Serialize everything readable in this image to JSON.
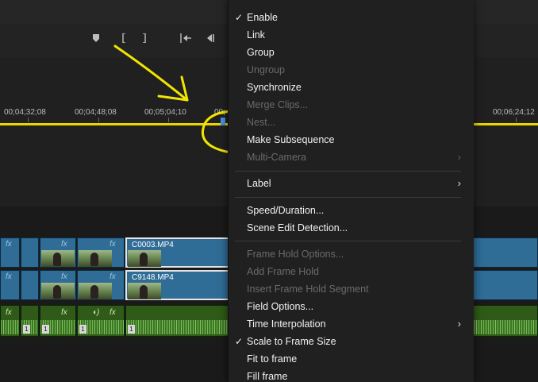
{
  "timeline": {
    "timecodes": [
      "00;04;32;08",
      "00;04;48;08",
      "00;05;04;10",
      "00;",
      "00;06;24;12"
    ],
    "toolbar_icons": [
      "marker-icon",
      "in-point-icon",
      "out-point-icon",
      "go-to-in-icon",
      "step-back-icon"
    ]
  },
  "tracks": {
    "video": [
      {
        "name": "C0003.MP4"
      },
      {
        "name": "C9148.MP4"
      }
    ],
    "fx_label": "fx",
    "audio_markers": [
      "1",
      "1",
      "1",
      "1"
    ]
  },
  "menu": {
    "items": [
      {
        "label": "Enable",
        "checked": true,
        "disabled": false,
        "submenu": false
      },
      {
        "label": "Link",
        "checked": false,
        "disabled": false,
        "submenu": false
      },
      {
        "label": "Group",
        "checked": false,
        "disabled": false,
        "submenu": false
      },
      {
        "label": "Ungroup",
        "checked": false,
        "disabled": true,
        "submenu": false
      },
      {
        "label": "Synchronize",
        "checked": false,
        "disabled": false,
        "submenu": false
      },
      {
        "label": "Merge Clips...",
        "checked": false,
        "disabled": true,
        "submenu": false
      },
      {
        "label": "Nest...",
        "checked": false,
        "disabled": true,
        "submenu": false
      },
      {
        "label": "Make Subsequence",
        "checked": false,
        "disabled": false,
        "submenu": false
      },
      {
        "label": "Multi-Camera",
        "checked": false,
        "disabled": true,
        "submenu": true
      },
      {
        "label": "Label",
        "checked": false,
        "disabled": false,
        "submenu": true
      },
      {
        "label": "Speed/Duration...",
        "checked": false,
        "disabled": false,
        "submenu": false
      },
      {
        "label": "Scene Edit Detection...",
        "checked": false,
        "disabled": false,
        "submenu": false
      },
      {
        "label": "Frame Hold Options...",
        "checked": false,
        "disabled": true,
        "submenu": false
      },
      {
        "label": "Add Frame Hold",
        "checked": false,
        "disabled": true,
        "submenu": false
      },
      {
        "label": "Insert Frame Hold Segment",
        "checked": false,
        "disabled": true,
        "submenu": false
      },
      {
        "label": "Field Options...",
        "checked": false,
        "disabled": false,
        "submenu": false
      },
      {
        "label": "Time Interpolation",
        "checked": false,
        "disabled": false,
        "submenu": true
      },
      {
        "label": "Scale to Frame Size",
        "checked": true,
        "disabled": false,
        "submenu": false
      },
      {
        "label": "Fit to frame",
        "checked": false,
        "disabled": false,
        "submenu": false
      },
      {
        "label": "Fill frame",
        "checked": false,
        "disabled": false,
        "submenu": false
      }
    ],
    "check_glyph": "✓",
    "chevron_glyph": "›"
  },
  "colors": {
    "annotation": "#f2e600",
    "timeline_line": "#e8d400",
    "video_clip": "#2f6c96",
    "audio_clip": "#2f5a17"
  }
}
